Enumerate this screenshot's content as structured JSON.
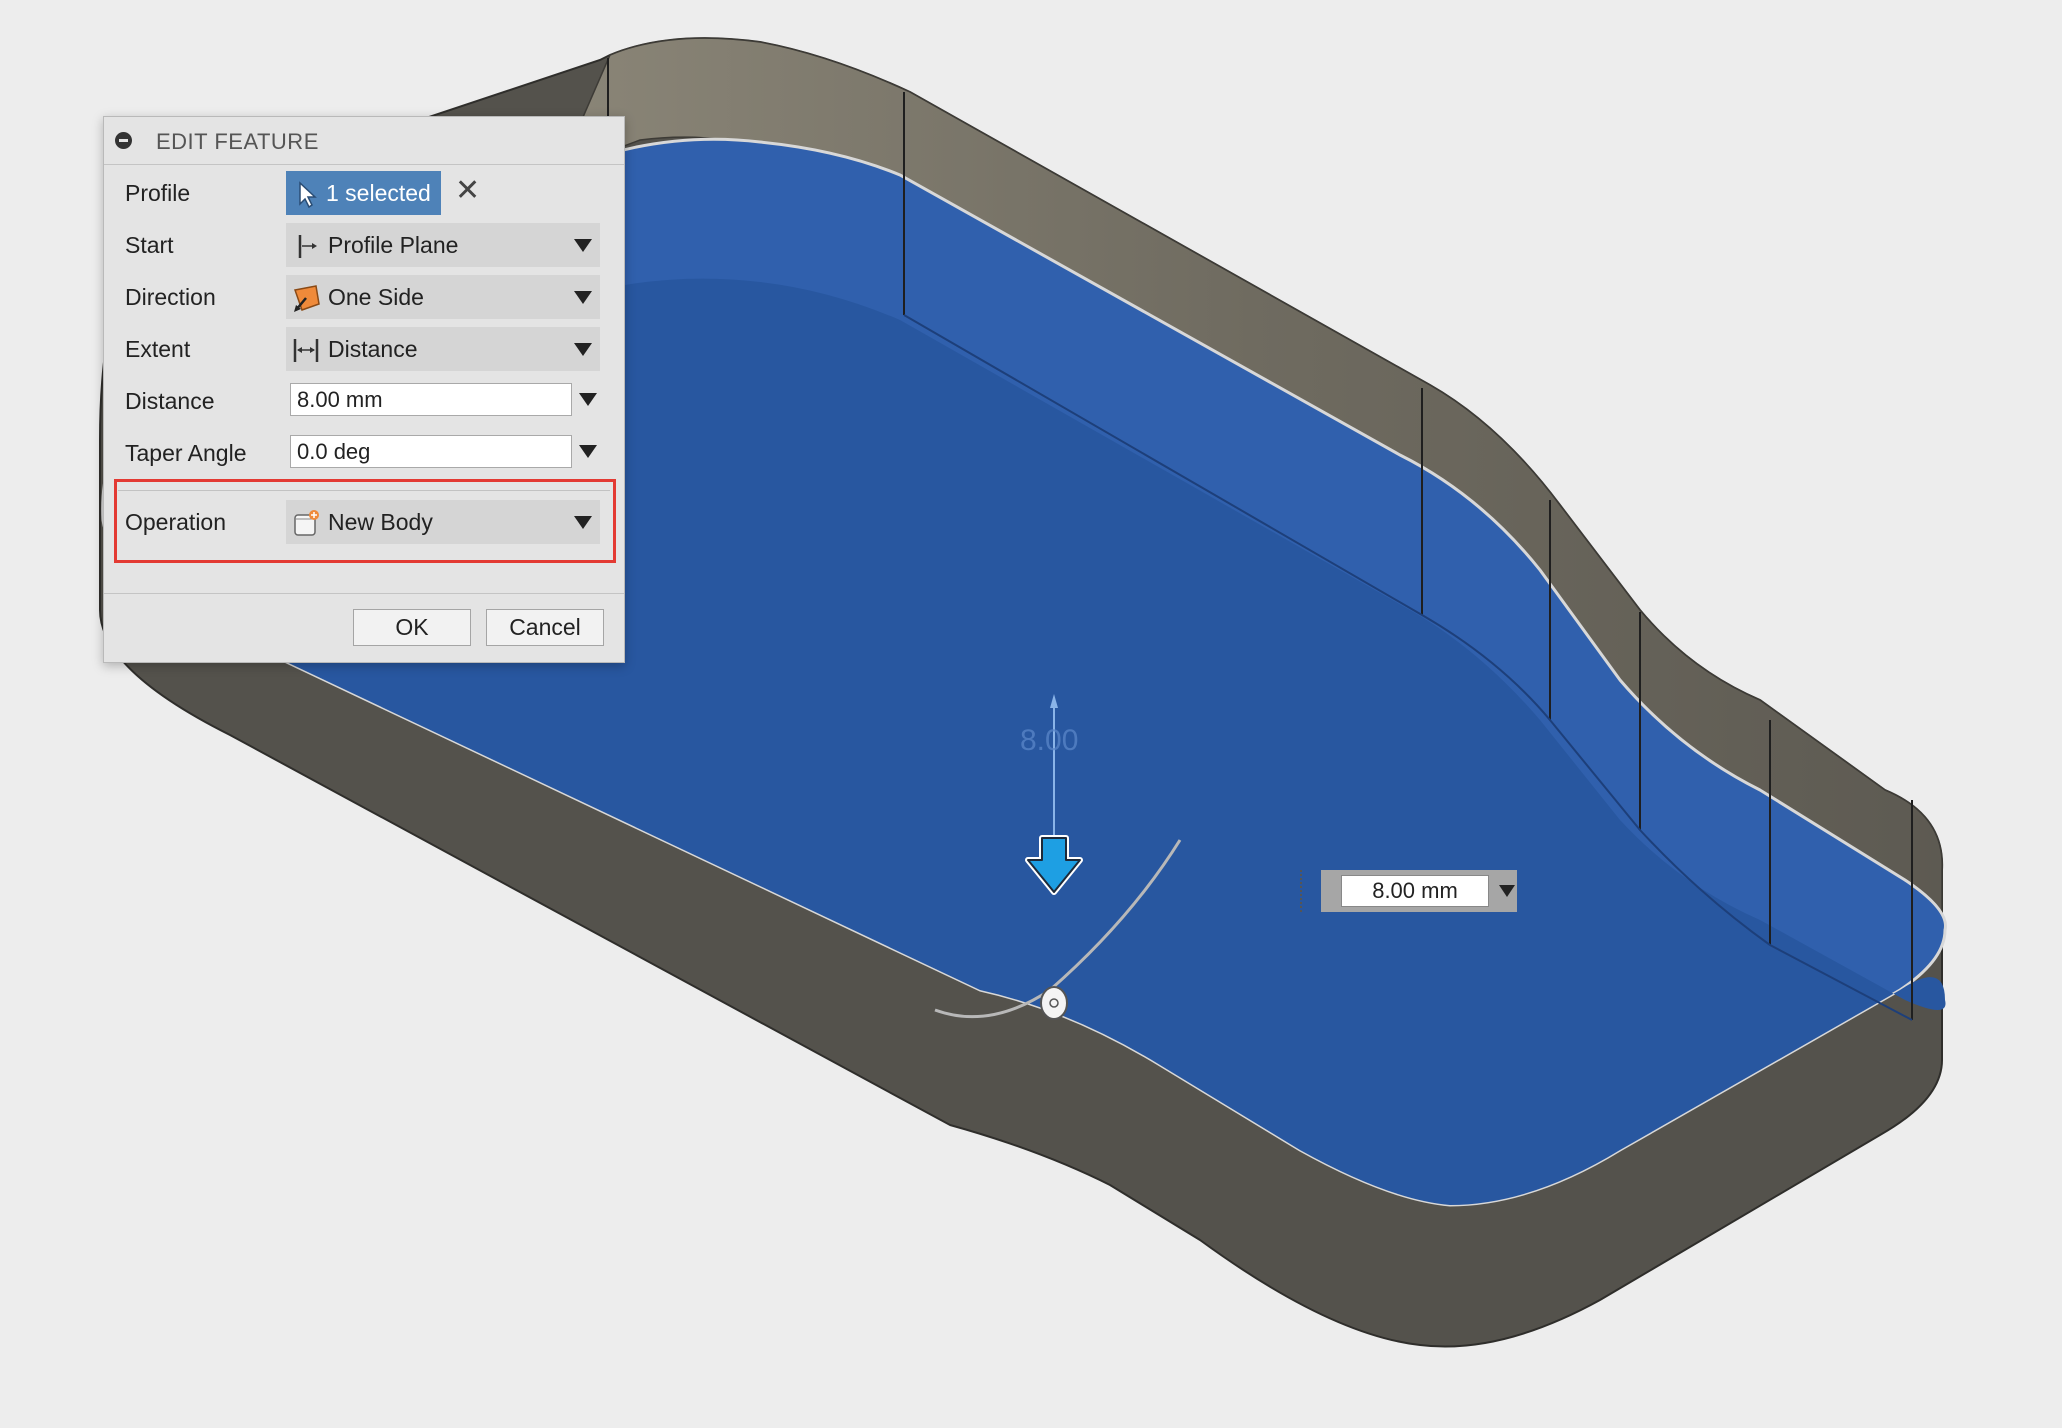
{
  "dialog": {
    "title": "EDIT FEATURE",
    "rows": {
      "profile": {
        "label": "Profile",
        "value": "1 selected"
      },
      "start": {
        "label": "Start",
        "value": "Profile Plane"
      },
      "direction": {
        "label": "Direction",
        "value": "One Side"
      },
      "extent": {
        "label": "Extent",
        "value": "Distance"
      },
      "distance": {
        "label": "Distance",
        "value": "8.00 mm"
      },
      "taper": {
        "label": "Taper Angle",
        "value": "0.0 deg"
      },
      "operation": {
        "label": "Operation",
        "value": "New Body"
      }
    },
    "buttons": {
      "ok": "OK",
      "cancel": "Cancel"
    },
    "highlight_color": "#e33a33"
  },
  "viewport": {
    "dimension_label": "8.00",
    "distance_manipulator_value": "8.00 mm",
    "icons": [
      "extrude-direction-arrow-icon",
      "angle-manipulator-handle-icon"
    ],
    "colors": {
      "background": "#ededed",
      "profile_face": "#2b5aa2",
      "body_side": "#5a5650",
      "body_top": "#6e6a60",
      "arrow": "#1e9fe3"
    }
  }
}
